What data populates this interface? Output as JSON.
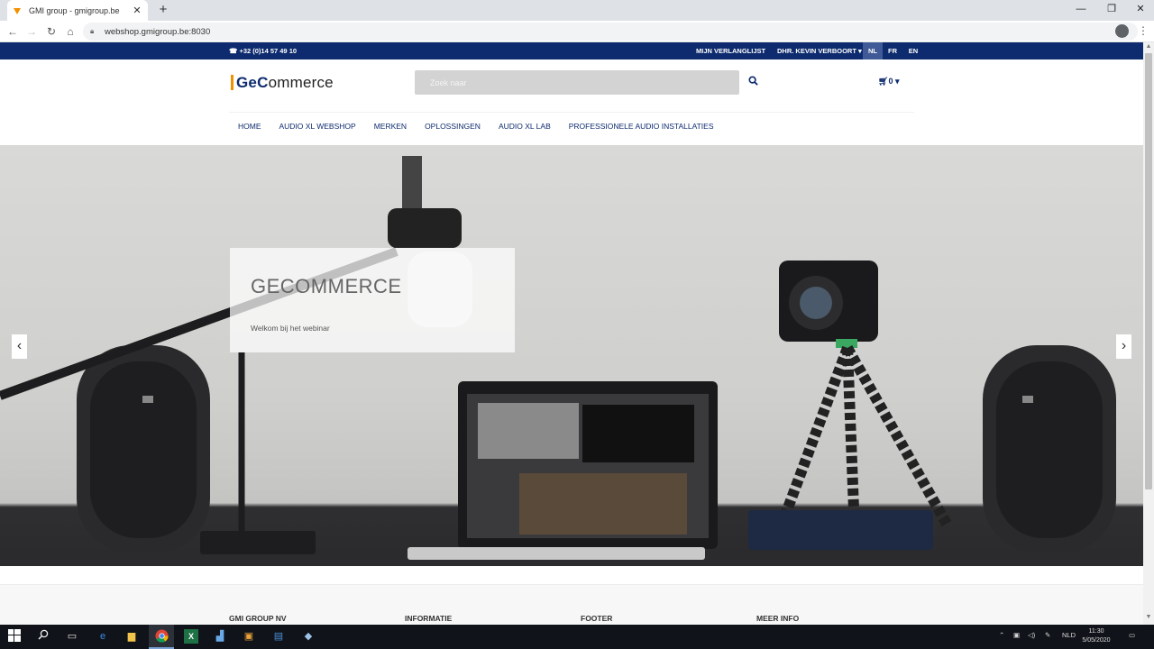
{
  "browser": {
    "tab_title": "GMI group - gmigroup.be",
    "url": "webshop.gmigroup.be:8030"
  },
  "topbar": {
    "phone": "+32 (0)14 57 49 10",
    "wishlist": "MIJN VERLANGLIJST",
    "user": "DHR. KEVIN VERBOORT",
    "languages": [
      "NL",
      "FR",
      "EN"
    ],
    "active_language": "NL"
  },
  "header": {
    "logo_bold": "GeC",
    "logo_rest": "ommerce",
    "search_placeholder": "Zoek naar",
    "cart_count": "0"
  },
  "menu": {
    "items": [
      "HOME",
      "AUDIO XL WEBSHOP",
      "MERKEN",
      "OPLOSSINGEN",
      "AUDIO XL LAB",
      "PROFESSIONELE AUDIO INSTALLATIES"
    ]
  },
  "slider": {
    "title": "GECOMMERCE",
    "text": "Welkom bij het webinar"
  },
  "footer": {
    "columns": [
      "GMI GROUP NV",
      "INFORMATIE",
      "FOOTER",
      "MEER INFO"
    ]
  },
  "taskbar": {
    "lang": "NLD",
    "time": "11:30",
    "date": "5/05/2020"
  },
  "colors": {
    "brand_navy": "#0d2b6e",
    "logo_accent": "#f29100"
  }
}
